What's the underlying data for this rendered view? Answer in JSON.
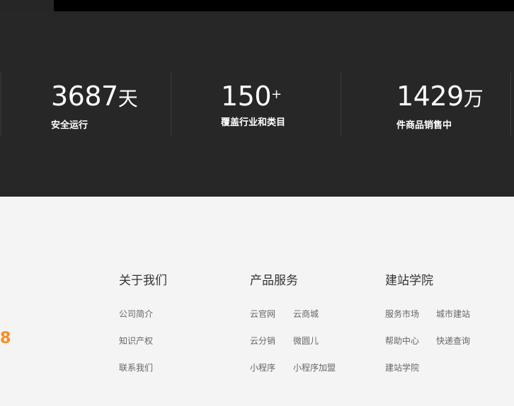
{
  "stats": [
    {
      "value": "3687",
      "unit": "天",
      "label": "安全运行"
    },
    {
      "value": "150",
      "sup": "+",
      "label": "覆盖行业和类目"
    },
    {
      "value": "1429",
      "unit": "万",
      "label": "件商品销售中"
    }
  ],
  "footer": {
    "phone_fragment": "8",
    "columns": [
      {
        "title": "关于我们",
        "links": [
          "公司简介",
          "知识产权",
          "联系我们"
        ]
      },
      {
        "title": "产品服务",
        "links": [
          "云官网",
          "云商城",
          "云分销",
          "微圆儿",
          "小程序",
          "小程序加盟"
        ]
      },
      {
        "title": "建站学院",
        "links": [
          "服务市场",
          "城市建站",
          "帮助中心",
          "快递查询",
          "建站学院"
        ]
      }
    ]
  },
  "colors": {
    "dark_bg": "#272727",
    "footer_bg": "#f4f4f4",
    "accent": "#ff8c1a"
  }
}
